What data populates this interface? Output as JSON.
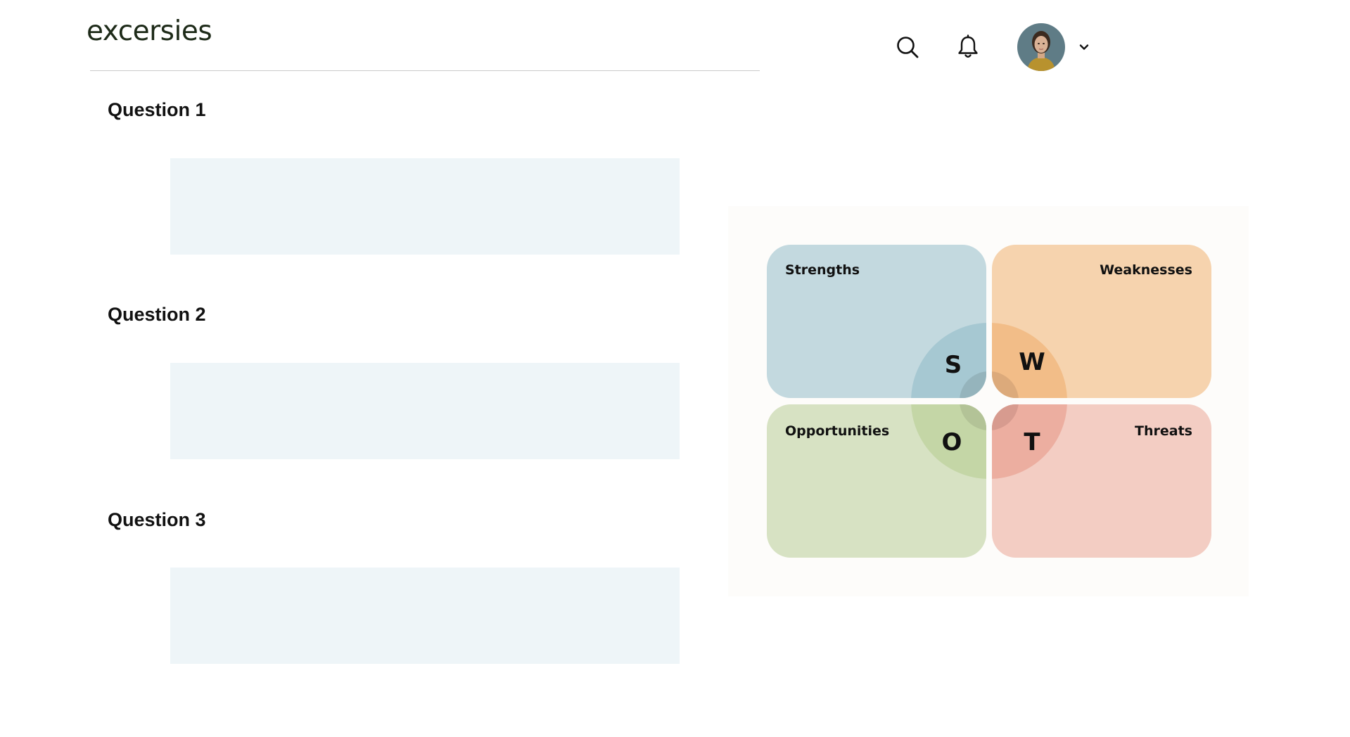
{
  "header": {
    "brand": "excersies",
    "icons": {
      "search": "search-icon",
      "notifications": "bell-icon",
      "menu": "chevron-down-icon"
    }
  },
  "questions": [
    {
      "title": "Question 1",
      "answer": ""
    },
    {
      "title": "Question 2",
      "answer": ""
    },
    {
      "title": "Question 3",
      "answer": ""
    }
  ],
  "swot": {
    "strengths": {
      "label": "Strengths",
      "letter": "S",
      "color": "#c3d9df"
    },
    "weaknesses": {
      "label": "Weaknesses",
      "letter": "W",
      "color": "#f6d3ae"
    },
    "opportunities": {
      "label": "Opportunities",
      "letter": "O",
      "color": "#d7e2c3"
    },
    "threats": {
      "label": "Threats",
      "letter": "T",
      "color": "#f3cdc3"
    }
  },
  "colors": {
    "answer_bg": "#eef5f8",
    "brand_text": "#1d2a18"
  }
}
